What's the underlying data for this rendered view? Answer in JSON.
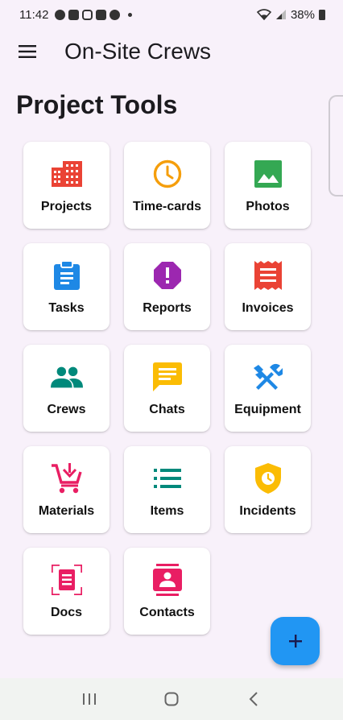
{
  "status_bar": {
    "time": "11:42",
    "battery": "38%",
    "notification_icons": [
      "messenger-icon",
      "message-icon",
      "instagram-icon",
      "linkedin-icon",
      "github-icon"
    ]
  },
  "app_bar": {
    "title": "On-Site Crews",
    "menu_icon": "hamburger-menu-icon"
  },
  "section": {
    "title": "Project Tools"
  },
  "tools": [
    {
      "label": "Projects",
      "icon": "building-icon",
      "color": "#ea4335"
    },
    {
      "label": "Time-cards",
      "icon": "clock-icon",
      "color": "#f59e0b"
    },
    {
      "label": "Photos",
      "icon": "image-icon",
      "color": "#34a853"
    },
    {
      "label": "Tasks",
      "icon": "clipboard-icon",
      "color": "#1e88e5"
    },
    {
      "label": "Reports",
      "icon": "alert-octagon-icon",
      "color": "#9c27b0"
    },
    {
      "label": "Invoices",
      "icon": "receipt-icon",
      "color": "#ea4335"
    },
    {
      "label": "Crews",
      "icon": "people-icon",
      "color": "#00897b"
    },
    {
      "label": "Chats",
      "icon": "chat-icon",
      "color": "#fbbc04"
    },
    {
      "label": "Equipment",
      "icon": "tools-icon",
      "color": "#1e88e5"
    },
    {
      "label": "Materials",
      "icon": "cart-icon",
      "color": "#e91e63"
    },
    {
      "label": "Items",
      "icon": "list-icon",
      "color": "#00897b"
    },
    {
      "label": "Incidents",
      "icon": "shield-clock-icon",
      "color": "#fbbc04"
    },
    {
      "label": "Docs",
      "icon": "document-scan-icon",
      "color": "#e91e63"
    },
    {
      "label": "Contacts",
      "icon": "contact-card-icon",
      "color": "#e91e63"
    }
  ],
  "fab": {
    "symbol": "+",
    "color": "#2196f3"
  },
  "nav_bar": {
    "back_icon": "back-icon",
    "home_icon": "home-icon",
    "recents_icon": "recents-icon"
  }
}
